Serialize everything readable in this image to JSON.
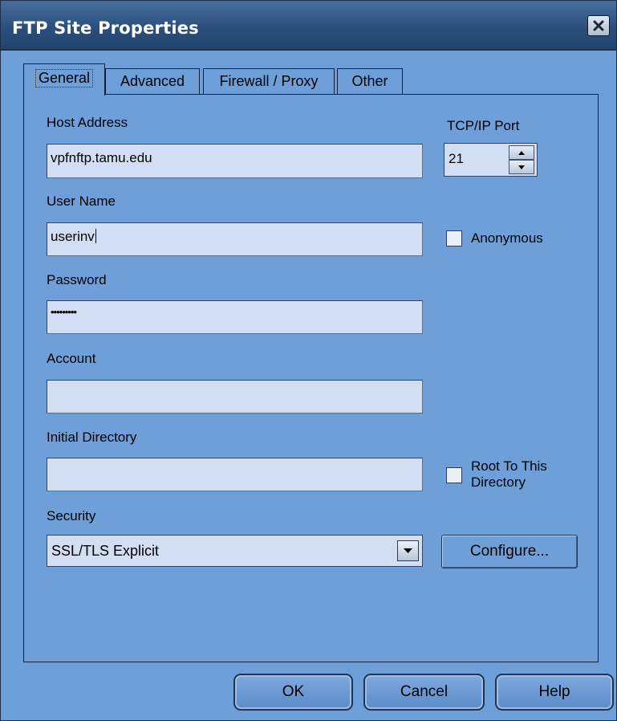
{
  "window": {
    "title": "FTP Site Properties"
  },
  "tabs": [
    {
      "label": "General",
      "active": true
    },
    {
      "label": "Advanced",
      "active": false
    },
    {
      "label": "Firewall / Proxy",
      "active": false
    },
    {
      "label": "Other",
      "active": false
    }
  ],
  "fields": {
    "host_address": {
      "label": "Host Address",
      "value": "vpfnftp.tamu.edu"
    },
    "tcp_ip_port": {
      "label": "TCP/IP Port",
      "value": "21"
    },
    "user_name": {
      "label": "User Name",
      "value": "userinv"
    },
    "anonymous": {
      "label": "Anonymous",
      "checked": false
    },
    "password": {
      "label": "Password",
      "value": "•••••••••"
    },
    "account": {
      "label": "Account",
      "value": ""
    },
    "initial_directory": {
      "label": "Initial Directory",
      "value": ""
    },
    "root_to_this_directory": {
      "label_line1": "Root To This",
      "label_line2": "Directory",
      "checked": false
    },
    "security": {
      "label": "Security",
      "value": "SSL/TLS Explicit"
    }
  },
  "buttons": {
    "configure": "Configure...",
    "ok": "OK",
    "cancel": "Cancel",
    "help": "Help"
  },
  "colors": {
    "window_bg": "#6f9fd8",
    "titlebar": "#2c4f7d",
    "input_bg": "#d2def4"
  }
}
